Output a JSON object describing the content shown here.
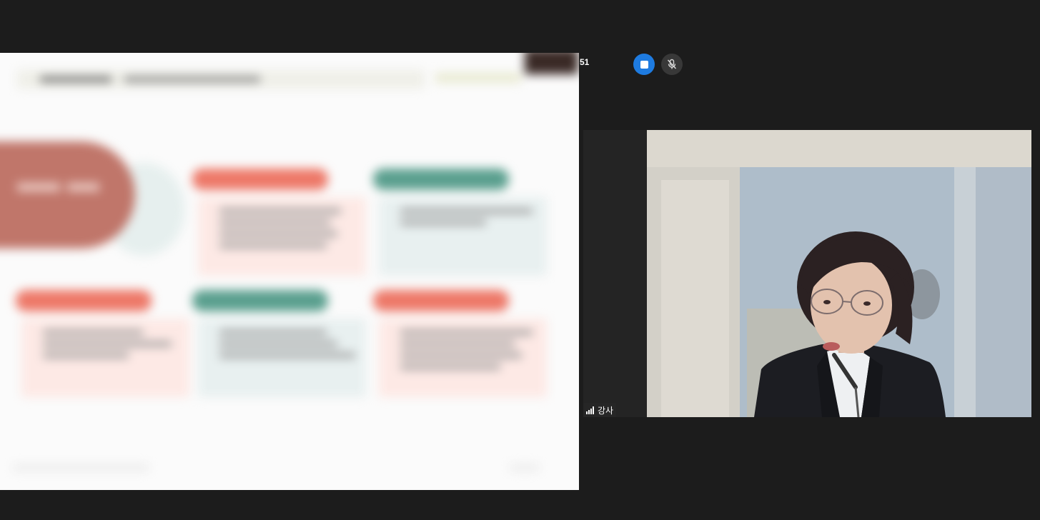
{
  "recording": {
    "timer_text": "51"
  },
  "controls": {
    "stop_icon": "stop-icon",
    "mute_icon": "mic-off-icon",
    "stop_color": "#1e7be0"
  },
  "participant": {
    "name": "강사",
    "signal_icon": "signal-bars-icon"
  },
  "shared_screen": {
    "content": "blurred-presentation-slide",
    "accent_colors": [
      "#ed7868",
      "#5a9f8e",
      "#c0766a"
    ]
  }
}
